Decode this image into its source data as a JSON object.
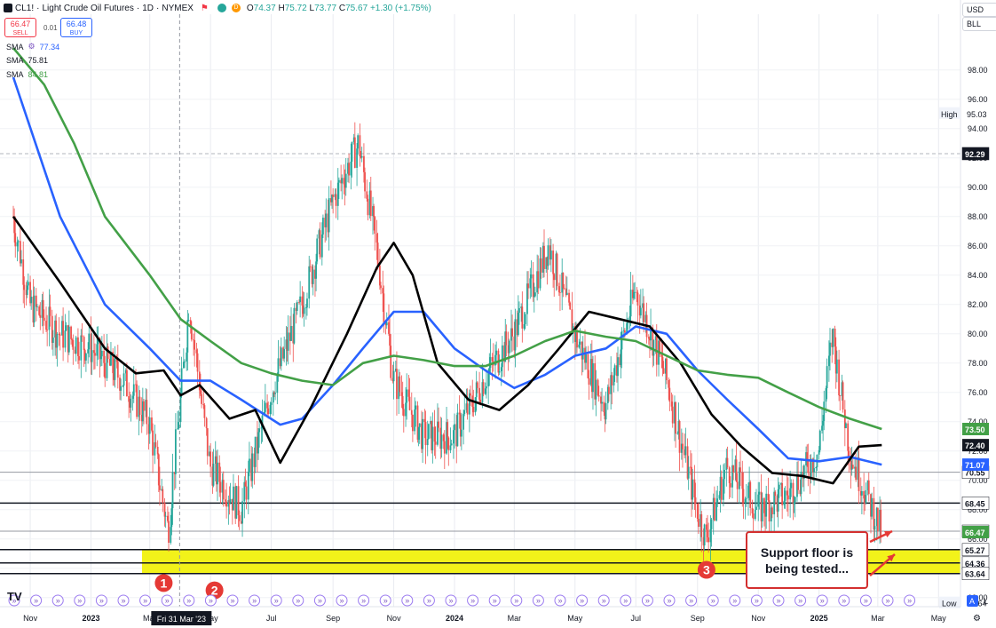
{
  "header": {
    "symbol": "CL1!",
    "title": "Light Crude Oil Futures",
    "interval": "1D",
    "exchange": "NYMEX",
    "badge_d": "D",
    "ohlc": {
      "o_label": "O",
      "o": "74.37",
      "h_label": "H",
      "h": "75.72",
      "l_label": "L",
      "l": "73.77",
      "c_label": "C",
      "c": "75.67",
      "change": "+1.30 (+1.75%)"
    },
    "sell": {
      "price": "66.47",
      "label": "SELL"
    },
    "buy": {
      "price": "66.48",
      "label": "BUY"
    },
    "spread": "0.01"
  },
  "indicators": [
    {
      "label": "SMA",
      "value": "77.34",
      "color": "#2962ff"
    },
    {
      "label": "SMA",
      "value": "75.81",
      "color": "#000000"
    },
    {
      "label": "SMA",
      "value": "84.81",
      "color": "#43a047"
    }
  ],
  "right_panel": {
    "currency": "USD",
    "unit": "BLL",
    "high_label": "High",
    "high": "95.03",
    "low_label": "Low",
    "low": "63.64"
  },
  "chart_data": {
    "type": "line",
    "subtype": "candlestick with moving averages",
    "symbol": "CL1!",
    "y_axis_ticks": [
      62,
      64,
      66,
      68,
      70,
      72,
      74,
      76,
      78,
      80,
      82,
      84,
      86,
      88,
      90,
      92,
      94,
      96,
      98
    ],
    "ylim": [
      61.5,
      100.5
    ],
    "x_axis_labels": [
      "Nov",
      "2023",
      "Mar",
      "May",
      "Jul",
      "Sep",
      "Nov",
      "2024",
      "Mar",
      "May",
      "Jul",
      "Sep",
      "Nov",
      "2025",
      "Mar",
      "May"
    ],
    "crosshair_label": "Fri 31 Mar '23",
    "x": [
      "2022-10-15",
      "2022-11-01",
      "2022-12-01",
      "2023-01-01",
      "2023-02-01",
      "2023-03-01",
      "2023-03-20",
      "2023-04-10",
      "2023-05-01",
      "2023-06-01",
      "2023-07-01",
      "2023-08-01",
      "2023-09-01",
      "2023-09-27",
      "2023-10-15",
      "2023-11-01",
      "2023-12-01",
      "2024-01-01",
      "2024-02-01",
      "2024-03-01",
      "2024-04-05",
      "2024-05-01",
      "2024-06-01",
      "2024-07-01",
      "2024-08-01",
      "2024-09-01",
      "2024-09-10",
      "2024-10-01",
      "2024-11-01",
      "2024-12-01",
      "2025-01-01",
      "2025-01-15",
      "2025-02-01",
      "2025-03-05"
    ],
    "series": [
      {
        "color": "#e57373",
        "values": [
          88,
          82,
          80,
          79,
          77,
          74,
          66.5,
          82,
          71,
          68,
          76,
          82,
          89,
          93,
          86,
          77,
          73,
          73,
          77,
          80,
          86,
          80,
          75,
          83,
          77,
          68,
          66,
          71,
          68,
          69,
          72,
          80,
          72,
          66.47
        ]
      },
      {
        "color": "#2962ff",
        "points": [
          [
            "2022-10-15",
            97.5
          ],
          [
            "2022-12-01",
            88
          ],
          [
            "2023-01-15",
            82
          ],
          [
            "2023-03-01",
            79
          ],
          [
            "2023-04-01",
            76.8
          ],
          [
            "2023-05-01",
            76.8
          ],
          [
            "2023-06-01",
            75.5
          ],
          [
            "2023-07-10",
            73.8
          ],
          [
            "2023-08-01",
            74.2
          ],
          [
            "2023-09-01",
            76.5
          ],
          [
            "2023-10-01",
            79
          ],
          [
            "2023-11-01",
            81.5
          ],
          [
            "2023-12-01",
            81.5
          ],
          [
            "2024-01-01",
            79
          ],
          [
            "2024-02-01",
            77.5
          ],
          [
            "2024-03-01",
            76.3
          ],
          [
            "2024-04-01",
            77.2
          ],
          [
            "2024-05-01",
            78.5
          ],
          [
            "2024-06-01",
            79
          ],
          [
            "2024-07-01",
            80.5
          ],
          [
            "2024-08-01",
            80
          ],
          [
            "2024-09-01",
            77.5
          ],
          [
            "2024-10-01",
            75.5
          ],
          [
            "2024-11-01",
            73.5
          ],
          [
            "2024-12-01",
            71.5
          ],
          [
            "2025-01-01",
            71.3
          ],
          [
            "2025-02-01",
            71.6
          ],
          [
            "2025-03-05",
            71.07
          ]
        ]
      },
      {
        "color": "#000000",
        "points": [
          [
            "2022-10-15",
            88
          ],
          [
            "2022-12-01",
            83.5
          ],
          [
            "2023-01-15",
            79
          ],
          [
            "2023-02-15",
            77.3
          ],
          [
            "2023-03-15",
            77.5
          ],
          [
            "2023-04-01",
            75.8
          ],
          [
            "2023-04-20",
            76.5
          ],
          [
            "2023-05-20",
            74.2
          ],
          [
            "2023-06-15",
            74.8
          ],
          [
            "2023-07-10",
            71.2
          ],
          [
            "2023-08-10",
            75
          ],
          [
            "2023-09-15",
            80
          ],
          [
            "2023-10-15",
            84.5
          ],
          [
            "2023-11-01",
            86.2
          ],
          [
            "2023-11-20",
            84
          ],
          [
            "2023-12-15",
            78
          ],
          [
            "2024-01-15",
            75.5
          ],
          [
            "2024-02-15",
            74.8
          ],
          [
            "2024-03-15",
            76.5
          ],
          [
            "2024-04-15",
            79
          ],
          [
            "2024-05-15",
            81.5
          ],
          [
            "2024-06-15",
            81
          ],
          [
            "2024-07-15",
            80.5
          ],
          [
            "2024-08-15",
            78
          ],
          [
            "2024-09-15",
            74.5
          ],
          [
            "2024-10-15",
            72.3
          ],
          [
            "2024-11-15",
            70.5
          ],
          [
            "2024-12-15",
            70.3
          ],
          [
            "2025-01-15",
            69.8
          ],
          [
            "2025-02-10",
            72.3
          ],
          [
            "2025-03-05",
            72.4
          ]
        ]
      },
      {
        "color": "#43a047",
        "points": [
          [
            "2022-10-15",
            99.5
          ],
          [
            "2022-11-15",
            97
          ],
          [
            "2022-12-15",
            93
          ],
          [
            "2023-01-15",
            88
          ],
          [
            "2023-03-01",
            84
          ],
          [
            "2023-04-01",
            81
          ],
          [
            "2023-05-01",
            79.5
          ],
          [
            "2023-06-01",
            78
          ],
          [
            "2023-07-01",
            77.3
          ],
          [
            "2023-08-01",
            76.8
          ],
          [
            "2023-09-01",
            76.5
          ],
          [
            "2023-10-01",
            78
          ],
          [
            "2023-11-01",
            78.5
          ],
          [
            "2023-12-01",
            78.2
          ],
          [
            "2024-01-01",
            77.8
          ],
          [
            "2024-02-01",
            77.8
          ],
          [
            "2024-03-01",
            78.5
          ],
          [
            "2024-04-01",
            79.5
          ],
          [
            "2024-05-01",
            80.2
          ],
          [
            "2024-06-01",
            79.8
          ],
          [
            "2024-07-01",
            79.5
          ],
          [
            "2024-08-01",
            78.5
          ],
          [
            "2024-09-01",
            77.5
          ],
          [
            "2024-10-01",
            77.2
          ],
          [
            "2024-11-01",
            77
          ],
          [
            "2024-12-01",
            76
          ],
          [
            "2025-01-01",
            75
          ],
          [
            "2025-02-01",
            74.2
          ],
          [
            "2025-03-05",
            73.5
          ]
        ]
      }
    ],
    "horizontal_levels": [
      {
        "value": 92.29,
        "label": "92.29",
        "style": "dashed-gray"
      },
      {
        "value": 70.55,
        "label": "70.55",
        "style": "gray"
      },
      {
        "value": 68.45,
        "label": "68.45",
        "style": "black"
      },
      {
        "value": 66.53,
        "label": "66.53",
        "style": "gray"
      },
      {
        "value": 65.27,
        "label": "65.27",
        "style": "black"
      },
      {
        "value": 64.36,
        "label": "64.36",
        "style": "black"
      },
      {
        "value": 63.64,
        "label": "63.64",
        "style": "black"
      }
    ],
    "price_tags": [
      {
        "value": 73.5,
        "label": "73.50",
        "bg": "#43a047"
      },
      {
        "value": 72.4,
        "label": "72.40",
        "bg": "#131722"
      },
      {
        "value": 71.07,
        "label": "71.07",
        "bg": "#2962ff"
      },
      {
        "value": 66.47,
        "label": "66.47",
        "bg": "#43a047"
      }
    ],
    "support_zone": {
      "from": 63.64,
      "to": 65.27,
      "color": "#f2f21a"
    },
    "markers": [
      {
        "label": "1",
        "x": "2023-03-15",
        "y": 63.6
      },
      {
        "label": "2",
        "x": "2023-05-05",
        "y": 63.1
      },
      {
        "label": "3",
        "x": "2024-09-10",
        "y": 64.5
      }
    ],
    "annotation": "Support floor is being tested..."
  }
}
